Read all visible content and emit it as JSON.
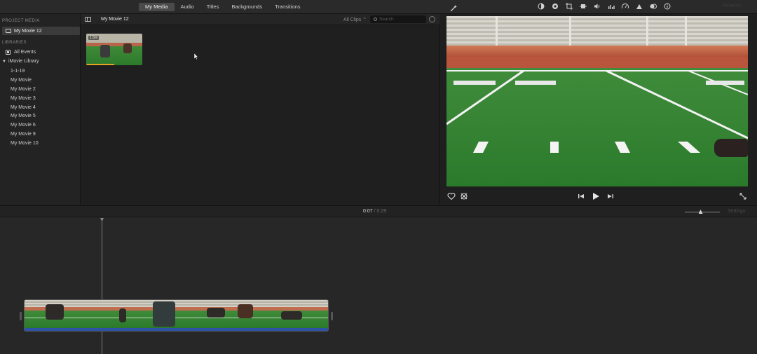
{
  "tabs": [
    {
      "label": "My Media",
      "active": true
    },
    {
      "label": "Audio",
      "active": false
    },
    {
      "label": "Titles",
      "active": false
    },
    {
      "label": "Backgrounds",
      "active": false
    },
    {
      "label": "Transitions",
      "active": false
    }
  ],
  "toolbar": {
    "reset_all_label": "Reset All",
    "icons": [
      "magic-wand-icon",
      "color-balance-icon",
      "color-correction-icon",
      "crop-icon",
      "stabilization-icon",
      "volume-icon",
      "equalizer-icon",
      "speed-icon",
      "noise-reduction-icon",
      "clip-filter-icon",
      "info-icon"
    ]
  },
  "sidebar": {
    "project_media_title": "PROJECT MEDIA",
    "project_item": "My Movie 12",
    "libraries_title": "LIBRARIES",
    "all_events": "All Events",
    "library_name": "iMovie Library",
    "events": [
      "1-1-19",
      "My Movie",
      "My Movie 2",
      "My Movie 3",
      "My Movie 4",
      "My Movie 5",
      "My Movie 6",
      "My Movie 9",
      "My Movie 10"
    ]
  },
  "browser": {
    "title": "My Movie 12",
    "filter_label": "All Clips ⌃",
    "search_placeholder": "Search",
    "clip": {
      "duration": "1.5m"
    }
  },
  "timeline": {
    "current_time": "0:07",
    "separator": "/",
    "total_time": "0:29",
    "settings_label": "Settings",
    "zoom_level": 0.45
  },
  "colors": {
    "accent_tab": "#4a4a4a",
    "audio_track": "#2d52a6",
    "used_clip_marker": "#e3a323"
  }
}
